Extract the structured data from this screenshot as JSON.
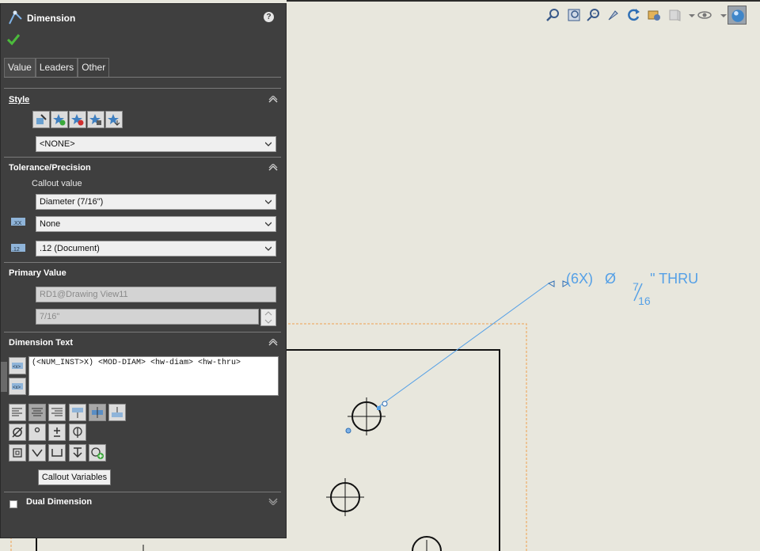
{
  "panel": {
    "title": "Dimension",
    "help": "?",
    "tabs": [
      "Value",
      "Leaders",
      "Other"
    ],
    "style": {
      "heading": "Style",
      "dropdown": "<NONE>",
      "icons": [
        "apply-default-style-icon",
        "add-style-icon",
        "delete-style-icon",
        "save-style-icon",
        "load-style-icon"
      ]
    },
    "tolerance": {
      "heading": "Tolerance/Precision",
      "callout_label": "Callout value",
      "callout_value": "Diameter (7/16\")",
      "tolerance_type": "None",
      "precision": ".12 (Document)"
    },
    "primary": {
      "heading": "Primary Value",
      "name": "RD1@Drawing View11",
      "value": "7/16\""
    },
    "dimtext": {
      "heading": "Dimension Text",
      "text": "(<NUM_INST>X) <MOD-DIAM> <hw-diam> <hw-thru>",
      "tooltip": "Callout Variables"
    },
    "dual": {
      "label": "Dual Dimension"
    }
  },
  "drawing": {
    "callout_prefix": "(6X)",
    "diameter_symbol": "Ø",
    "numerator": "7",
    "denominator": "16",
    "suffix": "\" THRU"
  },
  "colors": {
    "panel_bg": "#3f3f3f",
    "sheet_bg": "#e8e7dd",
    "annotation_blue": "#55a0e6",
    "selection_orange": "#f0a050",
    "check_green": "#4cbb3c"
  }
}
